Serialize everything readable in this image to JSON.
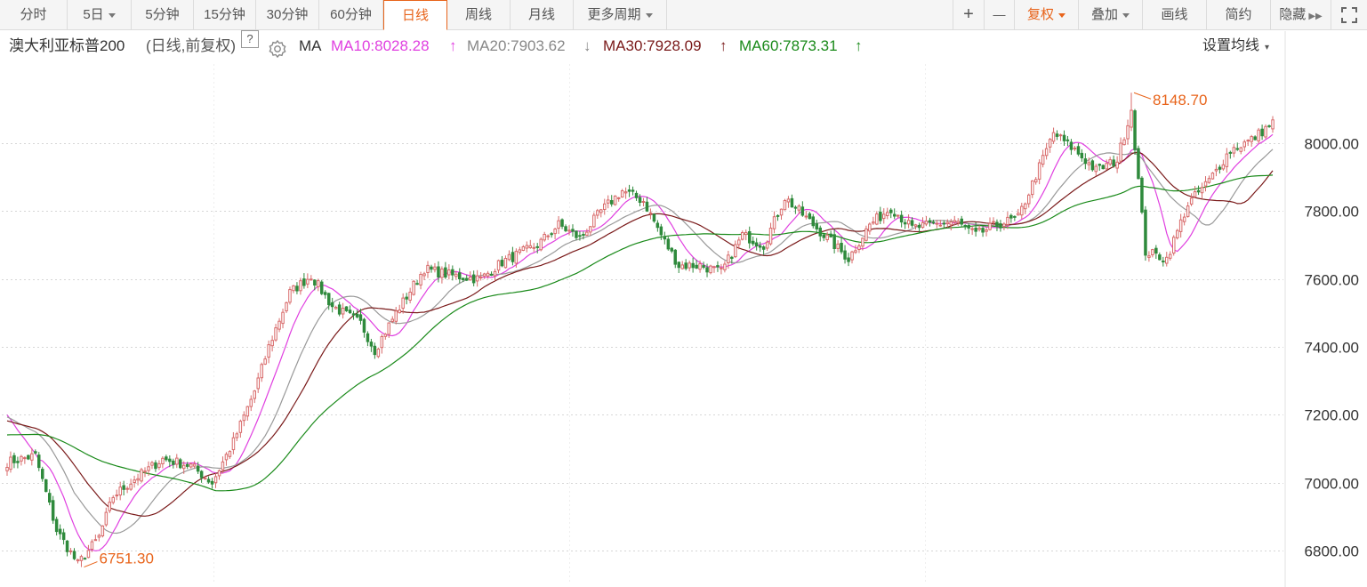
{
  "toolbar": {
    "left": [
      "分时",
      "5日",
      "5分钟",
      "15分钟",
      "30分钟",
      "60分钟",
      "日线",
      "周线",
      "月线",
      "更多周期"
    ],
    "active": "日线",
    "right": [
      "+",
      "—",
      "复权",
      "叠加",
      "画线",
      "简约",
      "隐藏"
    ]
  },
  "legend": {
    "name": "澳大利亚标普200",
    "mode": "(日线,前复权)",
    "help": "?",
    "ma": "MA",
    "ma10": "MA10:8028.28",
    "ma10_arrow": "↑",
    "ma20": "MA20:7903.62",
    "ma20_arrow": "↓",
    "ma30": "MA30:7928.09",
    "ma30_arrow": "↑",
    "ma60": "MA60:7873.31",
    "ma60_arrow": "↑",
    "settings": "设置均线"
  },
  "colors": {
    "up": "#d86a6a",
    "down": "#2f8a3c",
    "ma10": "#e040e0",
    "ma20": "#999999",
    "ma30": "#7a1a1a",
    "ma60": "#1a8a1a",
    "accent": "#e8641b"
  },
  "chart_data": {
    "type": "candlestick",
    "title": "澳大利亚标普200",
    "y_ticks": [
      "6800.00",
      "7000.00",
      "7200.00",
      "7400.00",
      "7600.00",
      "7800.00",
      "8000.00"
    ],
    "ylim": [
      6730,
      8180
    ],
    "max_label": "8148.70",
    "min_label": "6751.30",
    "anchors": [
      [
        0,
        7060
      ],
      [
        8,
        7080
      ],
      [
        14,
        6860
      ],
      [
        20,
        6760
      ],
      [
        26,
        6840
      ],
      [
        30,
        6960
      ],
      [
        36,
        7010
      ],
      [
        44,
        7070
      ],
      [
        52,
        7050
      ],
      [
        58,
        7000
      ],
      [
        64,
        7120
      ],
      [
        70,
        7270
      ],
      [
        74,
        7400
      ],
      [
        80,
        7560
      ],
      [
        86,
        7610
      ],
      [
        92,
        7520
      ],
      [
        100,
        7470
      ],
      [
        104,
        7390
      ],
      [
        110,
        7500
      ],
      [
        118,
        7630
      ],
      [
        126,
        7610
      ],
      [
        134,
        7600
      ],
      [
        140,
        7650
      ],
      [
        150,
        7700
      ],
      [
        156,
        7760
      ],
      [
        162,
        7720
      ],
      [
        168,
        7800
      ],
      [
        174,
        7860
      ],
      [
        180,
        7830
      ],
      [
        186,
        7710
      ],
      [
        190,
        7640
      ],
      [
        196,
        7640
      ],
      [
        202,
        7620
      ],
      [
        208,
        7730
      ],
      [
        214,
        7700
      ],
      [
        220,
        7840
      ],
      [
        226,
        7780
      ],
      [
        232,
        7720
      ],
      [
        238,
        7660
      ],
      [
        244,
        7760
      ],
      [
        250,
        7810
      ],
      [
        256,
        7750
      ],
      [
        262,
        7760
      ],
      [
        268,
        7770
      ],
      [
        274,
        7730
      ],
      [
        280,
        7760
      ],
      [
        286,
        7780
      ],
      [
        290,
        7880
      ],
      [
        296,
        8030
      ],
      [
        302,
        7980
      ],
      [
        308,
        7920
      ],
      [
        314,
        7950
      ],
      [
        318,
        8100
      ],
      [
        322,
        7680
      ],
      [
        328,
        7660
      ],
      [
        334,
        7820
      ],
      [
        340,
        7890
      ],
      [
        346,
        7980
      ],
      [
        352,
        8010
      ],
      [
        358,
        8060
      ]
    ],
    "ma_periods": [
      10,
      20,
      30,
      60
    ]
  }
}
